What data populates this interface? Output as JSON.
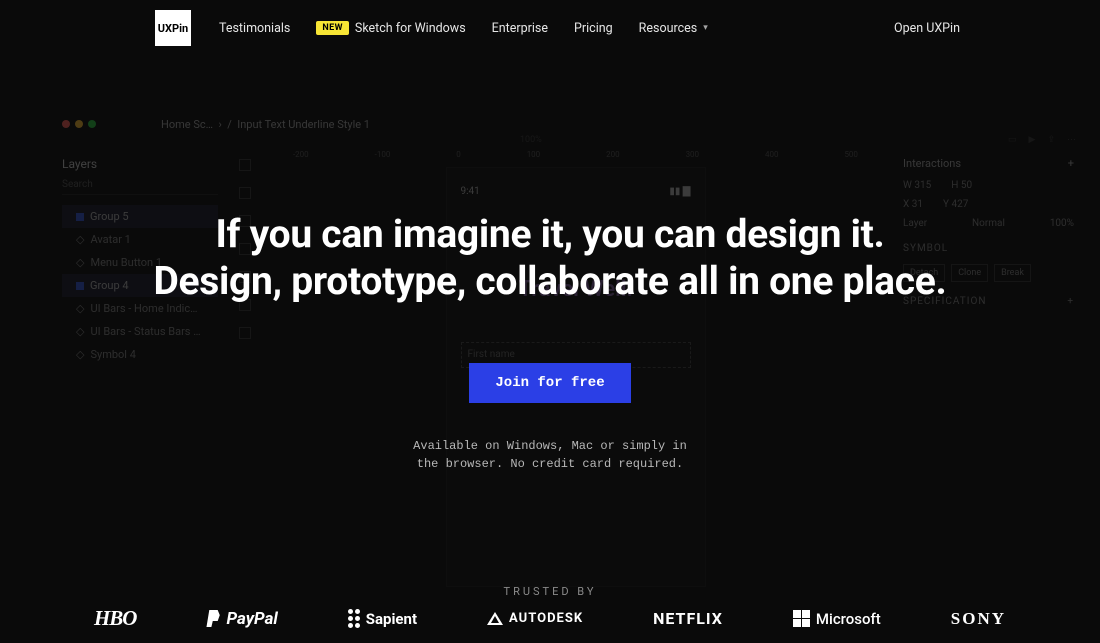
{
  "nav": {
    "logo": "UXPin",
    "links": {
      "testimonials": "Testimonials",
      "new_badge": "NEW",
      "sketch": "Sketch for Windows",
      "enterprise": "Enterprise",
      "pricing": "Pricing",
      "resources": "Resources"
    },
    "open": "Open UXPin"
  },
  "hero": {
    "headline_l1": "If you can imagine it, you can design it.",
    "headline_l2": "Design, prototype, collaborate all in one place.",
    "cta": "Join for free",
    "sub_l1": "Available on Windows, Mac or simply in",
    "sub_l2": "the browser. No credit card required.",
    "trusted": "TRUSTED BY"
  },
  "brands": {
    "hbo": "HBO",
    "paypal": "PayPal",
    "sapient": "Sapient",
    "autodesk": "AUTODESK",
    "netflix": "NETFLIX",
    "microsoft": "Microsoft",
    "sony": "SONY"
  },
  "bg": {
    "crumb1": "Home Sc…",
    "crumb2": "Input Text Underline Style 1",
    "zoom": "100%",
    "left": {
      "title": "Layers",
      "search": "Search",
      "items": [
        "Group 5",
        "Avatar 1",
        "Menu Button 1",
        "Group 4",
        "UI Bars - Home Indic…",
        "UI Bars - Status Bars …",
        "Symbol 4"
      ]
    },
    "phone": {
      "time": "9:41",
      "travel": "Travel Well!",
      "field": "First name"
    },
    "right": {
      "interactions": "Interactions",
      "w": "315",
      "h": "50",
      "x": "31",
      "y": "427",
      "layer": "Layer",
      "normal": "Normal",
      "pct": "100%",
      "symbol": "SYMBOL",
      "detach": "Detach",
      "clone": "Clone",
      "break": "Break",
      "spec": "SPECIFICATION"
    },
    "ruler": [
      "-200",
      "-100",
      "0",
      "100",
      "200",
      "300",
      "400",
      "500"
    ]
  }
}
